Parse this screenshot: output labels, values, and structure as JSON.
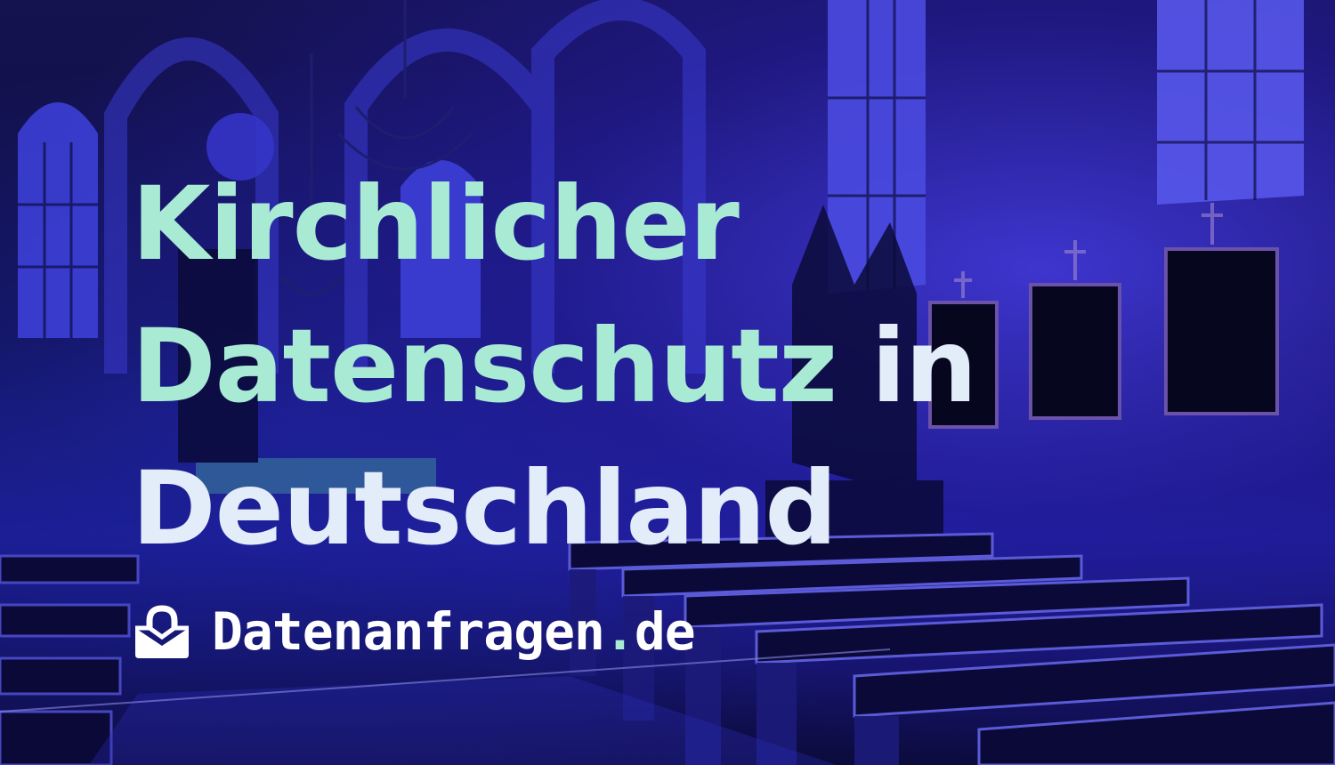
{
  "title": {
    "line1": "Kirchlicher",
    "line2a": "Datenschutz",
    "line2b": " in",
    "line3": "Deutschland"
  },
  "brand": {
    "icon": "lock-mail-icon",
    "name": "Datenanfragen",
    "dot": ".",
    "tld": "de"
  },
  "colors": {
    "accent": "#a8ead4",
    "light": "#e3ecf9",
    "background": "#14124f"
  }
}
